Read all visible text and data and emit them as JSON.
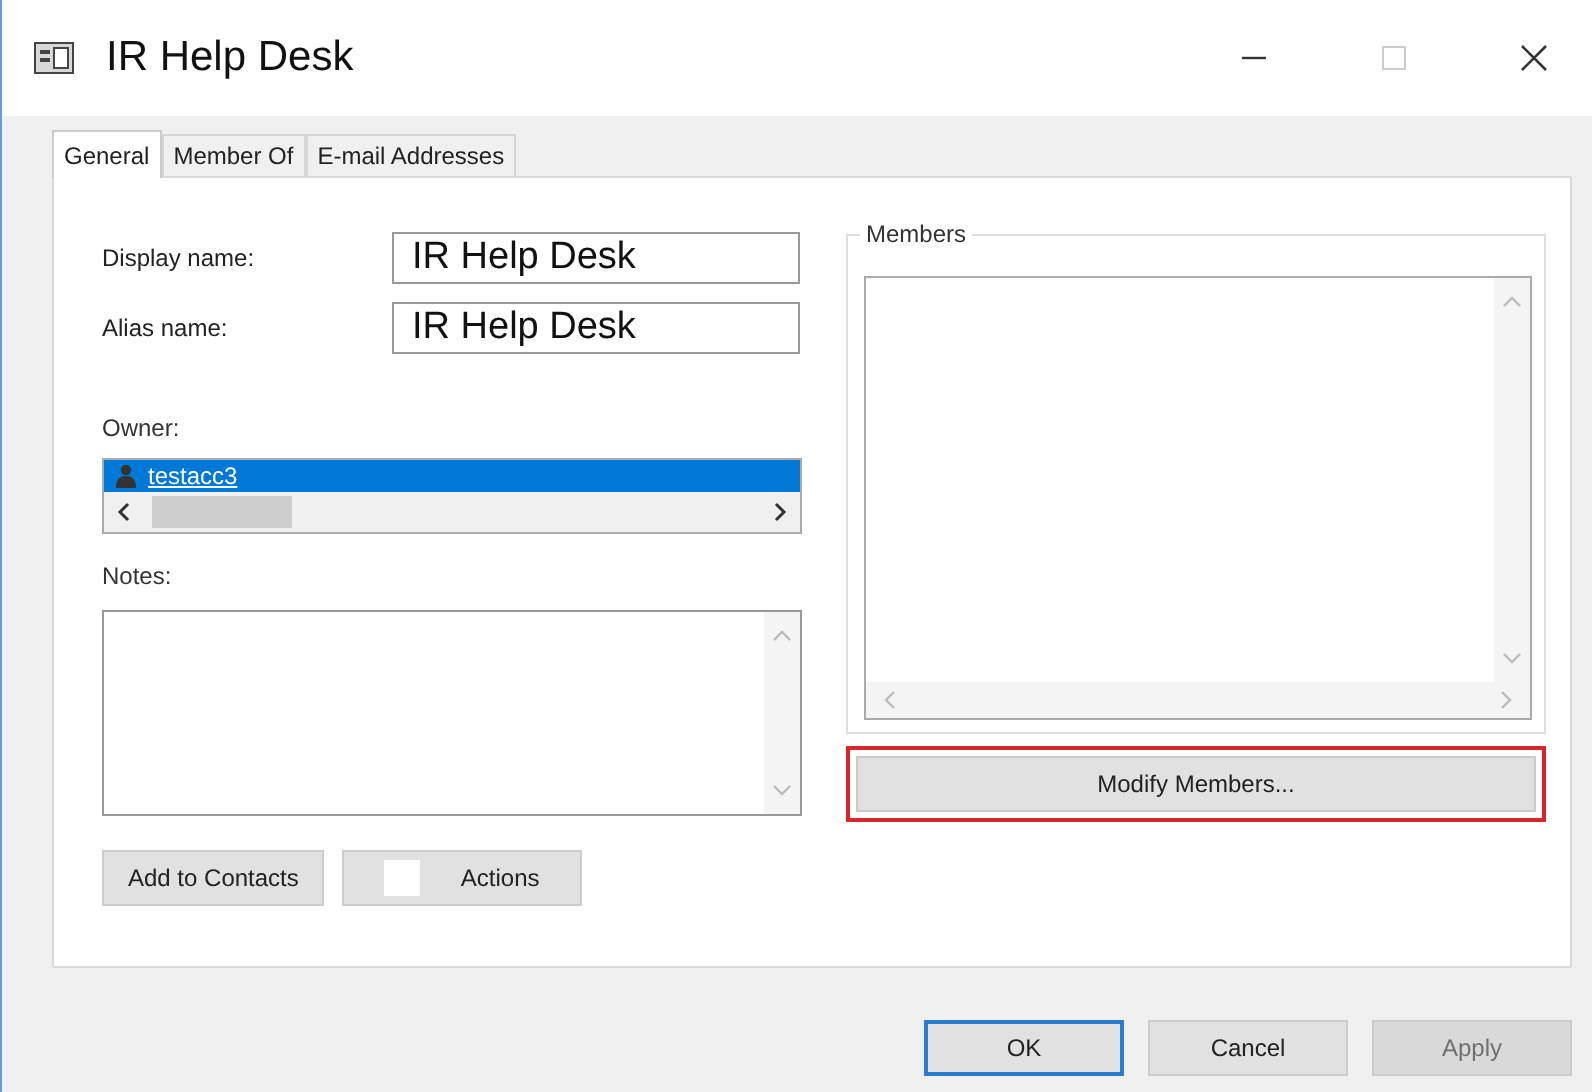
{
  "window": {
    "title": "IR Help Desk"
  },
  "tabs": [
    {
      "label": "General",
      "selected": true
    },
    {
      "label": "Member Of",
      "selected": false
    },
    {
      "label": "E-mail Addresses",
      "selected": false
    }
  ],
  "fields": [
    {
      "label": "Display name:",
      "value": "IR Help Desk"
    },
    {
      "label": "Alias name:",
      "value": "IR Help Desk"
    }
  ],
  "owner": {
    "label": "Owner:",
    "items": [
      {
        "name": "testacc3",
        "selected": true
      }
    ]
  },
  "notes": {
    "label": "Notes:"
  },
  "left_buttons": [
    {
      "label": "Add to Contacts",
      "kind": "plain"
    },
    {
      "label": "Actions",
      "kind": "icon"
    }
  ],
  "members": {
    "legend": "Members",
    "button": {
      "label": "Modify Members...",
      "highlighted": true
    }
  },
  "dialog_buttons": [
    {
      "label": "OK",
      "default": true,
      "disabled": false
    },
    {
      "label": "Cancel",
      "default": false,
      "disabled": false
    },
    {
      "label": "Apply",
      "default": false,
      "disabled": true
    }
  ]
}
